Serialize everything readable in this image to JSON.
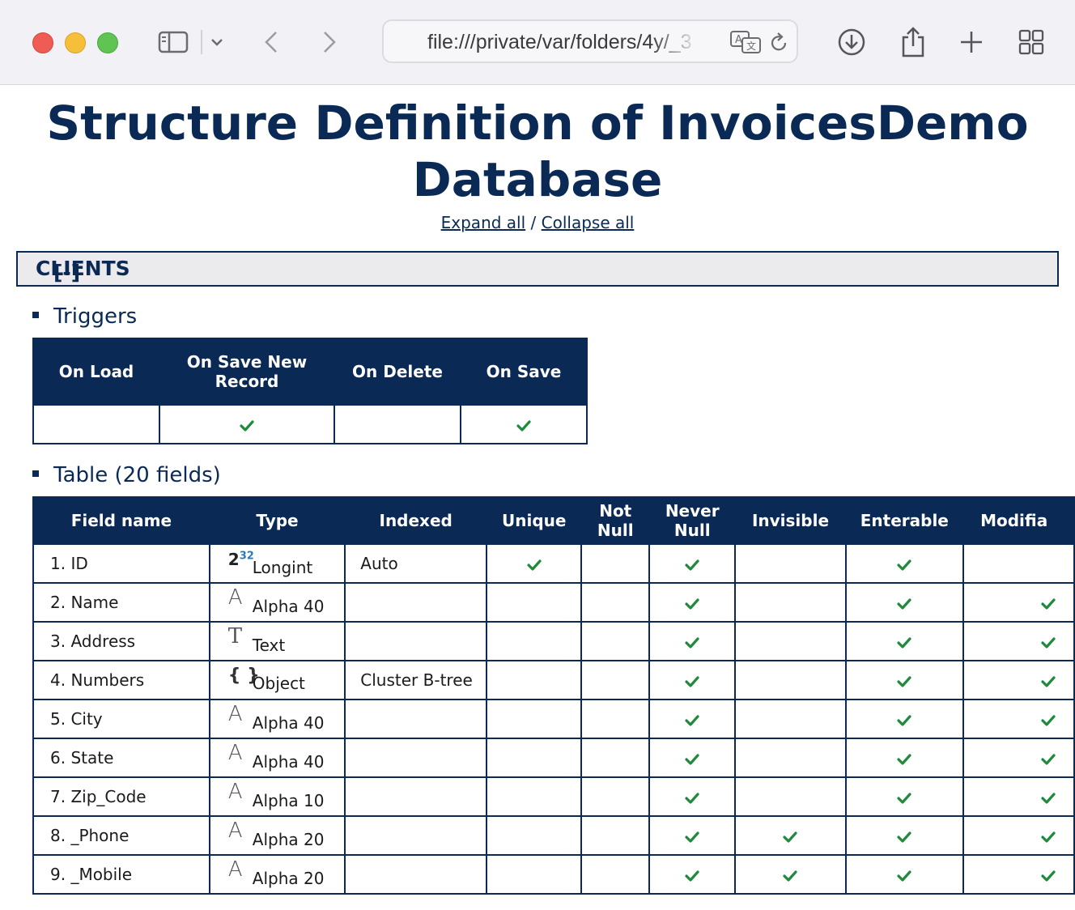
{
  "browser": {
    "url": "file:///private/var/folders/4y/_3",
    "icons": [
      "sidebar-icon",
      "chevron-down-icon",
      "back-icon",
      "forward-icon",
      "translate-icon",
      "reload-icon",
      "download-icon",
      "share-icon",
      "new-tab-icon",
      "tab-overview-icon"
    ]
  },
  "page": {
    "title": "Structure Definition of InvoicesDemo Database",
    "expand_all": "Expand all",
    "separator": "/",
    "collapse_all": "Collapse all"
  },
  "section": {
    "toggle": "[-]",
    "name": "CLIENTS"
  },
  "triggers": {
    "heading": "Triggers",
    "columns": [
      "On Load",
      "On Save New Record",
      "On Delete",
      "On Save"
    ],
    "values": [
      false,
      true,
      false,
      true
    ],
    "check_color": "#1f8a3b"
  },
  "table": {
    "heading": "Table (20 fields)",
    "columns": [
      "Field name",
      "Type",
      "Indexed",
      "Unique",
      "Not Null",
      "Never Null",
      "Invisible",
      "Enterable",
      "Modifia"
    ],
    "rows": [
      {
        "name": "1. ID",
        "icon": "longint-icon",
        "type": "Longint",
        "indexed": "Auto",
        "unique": true,
        "notnull": false,
        "nevernull": true,
        "invisible": false,
        "enterable": true,
        "modifiable": false
      },
      {
        "name": "2. Name",
        "icon": "alpha-icon",
        "type": "Alpha 40",
        "indexed": "",
        "unique": false,
        "notnull": false,
        "nevernull": true,
        "invisible": false,
        "enterable": true,
        "modifiable": true
      },
      {
        "name": "3. Address",
        "icon": "text-icon",
        "type": "Text",
        "indexed": "",
        "unique": false,
        "notnull": false,
        "nevernull": true,
        "invisible": false,
        "enterable": true,
        "modifiable": true
      },
      {
        "name": "4. Numbers",
        "icon": "object-icon",
        "type": "Object",
        "indexed": "Cluster B-tree",
        "unique": false,
        "notnull": false,
        "nevernull": true,
        "invisible": false,
        "enterable": true,
        "modifiable": true
      },
      {
        "name": "5. City",
        "icon": "alpha-icon",
        "type": "Alpha 40",
        "indexed": "",
        "unique": false,
        "notnull": false,
        "nevernull": true,
        "invisible": false,
        "enterable": true,
        "modifiable": true
      },
      {
        "name": "6. State",
        "icon": "alpha-icon",
        "type": "Alpha 40",
        "indexed": "",
        "unique": false,
        "notnull": false,
        "nevernull": true,
        "invisible": false,
        "enterable": true,
        "modifiable": true
      },
      {
        "name": "7. Zip_Code",
        "icon": "alpha-icon",
        "type": "Alpha 10",
        "indexed": "",
        "unique": false,
        "notnull": false,
        "nevernull": true,
        "invisible": false,
        "enterable": true,
        "modifiable": true
      },
      {
        "name": "8. _Phone",
        "icon": "alpha-icon",
        "type": "Alpha 20",
        "indexed": "",
        "unique": false,
        "notnull": false,
        "nevernull": true,
        "invisible": true,
        "enterable": true,
        "modifiable": true
      },
      {
        "name": "9. _Mobile",
        "icon": "alpha-icon",
        "type": "Alpha 20",
        "indexed": "",
        "unique": false,
        "notnull": false,
        "nevernull": true,
        "invisible": true,
        "enterable": true,
        "modifiable": true
      }
    ],
    "type_glyphs": {
      "alpha-icon": "A",
      "text-icon": "T",
      "object-icon": "{ }",
      "longint-base": "2",
      "longint-exp": "32"
    }
  }
}
